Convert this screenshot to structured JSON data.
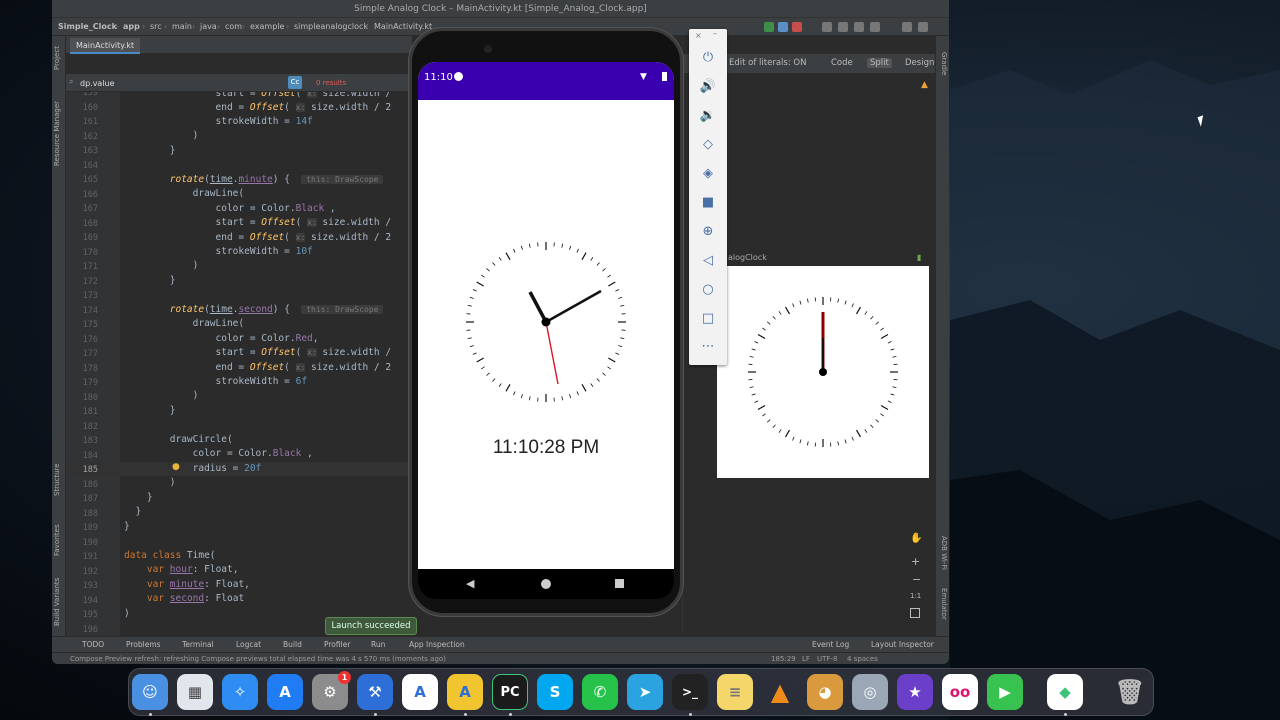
{
  "window": {
    "title": "Simple Analog Clock – MainActivity.kt [Simple_Analog_Clock.app]"
  },
  "breadcrumbs": [
    "Simple_Clock",
    "app",
    "src",
    "main",
    "java",
    "com",
    "example",
    "simpleanalogclock",
    "MainActivity.kt"
  ],
  "file_tab": "MainActivity.kt",
  "sidebar_left": [
    "Project",
    "Resource Manager",
    "Structure",
    "Favorites",
    "Build Variants"
  ],
  "sidebar_right": [
    "Gradle",
    "ADB Wi-Fi",
    "Emulator"
  ],
  "find": {
    "value": "dp.value",
    "results": "0 results",
    "cc_label": "Cc"
  },
  "code": {
    "line_numbers": [
      "159",
      "160",
      "161",
      "162",
      "163",
      "164",
      "165",
      "166",
      "167",
      "168",
      "169",
      "170",
      "171",
      "172",
      "173",
      "174",
      "175",
      "176",
      "177",
      "178",
      "179",
      "180",
      "181",
      "182",
      "183",
      "184",
      "185",
      "186",
      "187",
      "188",
      "189",
      "190",
      "191",
      "192",
      "193",
      "194",
      "195",
      "196"
    ],
    "current_line": "185"
  },
  "preview": {
    "toolbar_literals": "Edit of literals: ON",
    "code_label": "Code",
    "split_label": "Split",
    "design_label": "Design",
    "card_label": "alogClock"
  },
  "phone": {
    "status_time": "11:10",
    "digital_time": "11:10:28 PM"
  },
  "toast": "Launch succeeded",
  "bottom_tools": {
    "todo": "TODO",
    "problems": "Problems",
    "terminal": "Terminal",
    "logcat": "Logcat",
    "build": "Build",
    "profiler": "Profiler",
    "run": "Run",
    "app_inspection": "App Inspection",
    "event_log": "Event Log",
    "layout_inspector": "Layout Inspector"
  },
  "status": {
    "message": "Compose Preview refresh: refreshing Compose previews total elapsed time was 4 s 570 ms (moments ago)",
    "position": "185:29",
    "line_sep": "LF",
    "encoding": "UTF-8",
    "indent": "4 spaces"
  },
  "emulator_zoom": "1:1",
  "dock": {
    "pycharm_label": "PC",
    "settings_badge": "1",
    "apps": [
      "finder",
      "launchpad",
      "safari",
      "app-store",
      "system-preferences",
      "xcode",
      "android-studio-alt",
      "android-studio",
      "pycharm",
      "skype",
      "whatsapp",
      "telegram",
      "terminal",
      "stickies",
      "vlc",
      "cyberduck",
      "screen-capture",
      "imovie",
      "flickr",
      "facetime",
      "android-studio-emulator",
      "trash"
    ]
  },
  "colors": {
    "app_bar": "#3a00b0",
    "second_hand": "#e0142a",
    "toast": "#3e5a3a"
  }
}
